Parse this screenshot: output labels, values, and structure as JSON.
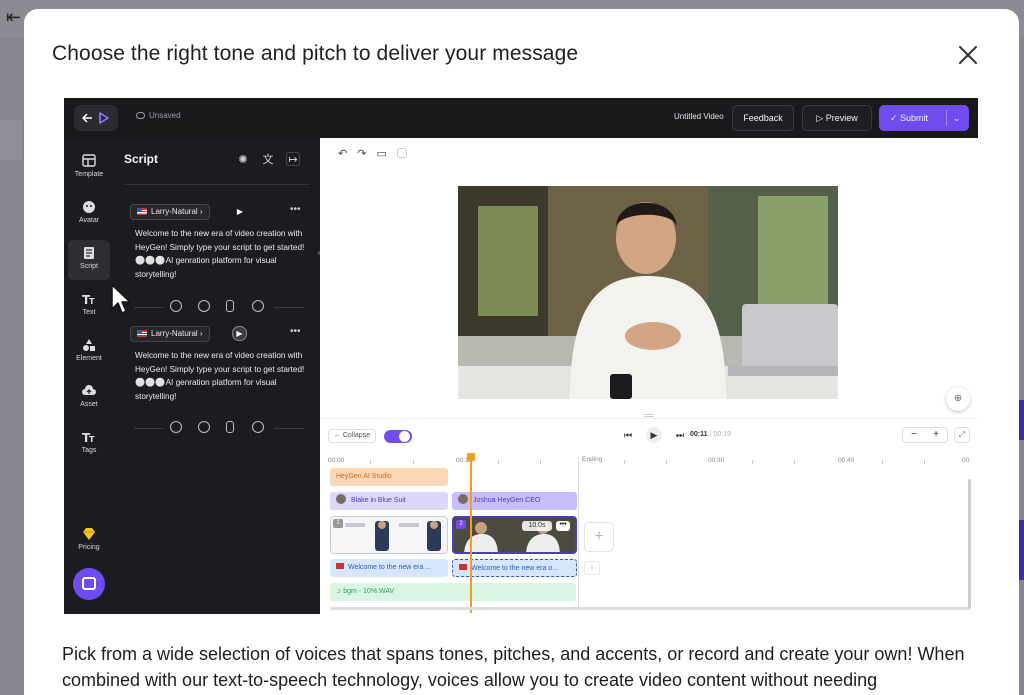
{
  "modal": {
    "title": "Choose the right tone and pitch to deliver your message",
    "description": "Pick from a wide selection of voices that spans tones, pitches, and accents, or record and create your own! When combined with our text-to-speech technology, voices allow you to create video content without needing"
  },
  "app": {
    "topbar": {
      "unsaved": "Unsaved",
      "video_title": "Untitled Video",
      "feedback": "Feedback",
      "preview": "Preview",
      "submit": "Submit"
    },
    "rail": [
      {
        "label": "Template",
        "icon": "template-icon"
      },
      {
        "label": "Avatar",
        "icon": "avatar-icon"
      },
      {
        "label": "Script",
        "icon": "script-icon",
        "active": true
      },
      {
        "label": "Text",
        "icon": "text-icon"
      },
      {
        "label": "Element",
        "icon": "element-icon"
      },
      {
        "label": "Asset",
        "icon": "asset-icon"
      },
      {
        "label": "Tags",
        "icon": "tags-icon"
      },
      {
        "label": "Pricing",
        "icon": "diamond-icon"
      }
    ],
    "script_panel": {
      "title": "Script",
      "blocks": [
        {
          "voice": "Larry-Natural",
          "text": "Welcome to the new era of video creation with HeyGen! Simply type your script to get started! ⚪⚪⚪AI genration platform for visual storytelling!"
        },
        {
          "voice": "Larry-Natural",
          "text": "Welcome to the new era of video creation with HeyGen! Simply type your script to get started! ⚪⚪⚪AI genration platform for visual storytelling!"
        }
      ]
    },
    "timeline": {
      "collapse": "Collapse",
      "time_current": "00:11",
      "time_total": "/ 00:19",
      "ruler": [
        "00:00",
        "00:10",
        "Ending",
        "00:30",
        "00:40",
        "00:"
      ],
      "tracks": {
        "studio": "HeyGen AI Studio",
        "avatar1": "Blake in Blue Suit",
        "avatar2": "Joshua HeyGen CEO",
        "clip_duration": "10.0s",
        "script1": "Welcome to the new era ...",
        "script2": "Welcome to the new era o...",
        "bgm": "bgm - 10%.WAV",
        "clip1_num": "1",
        "clip2_num": "2"
      }
    }
  },
  "colors": {
    "accent": "#6e4cf0",
    "playhead": "#f2a01b"
  }
}
